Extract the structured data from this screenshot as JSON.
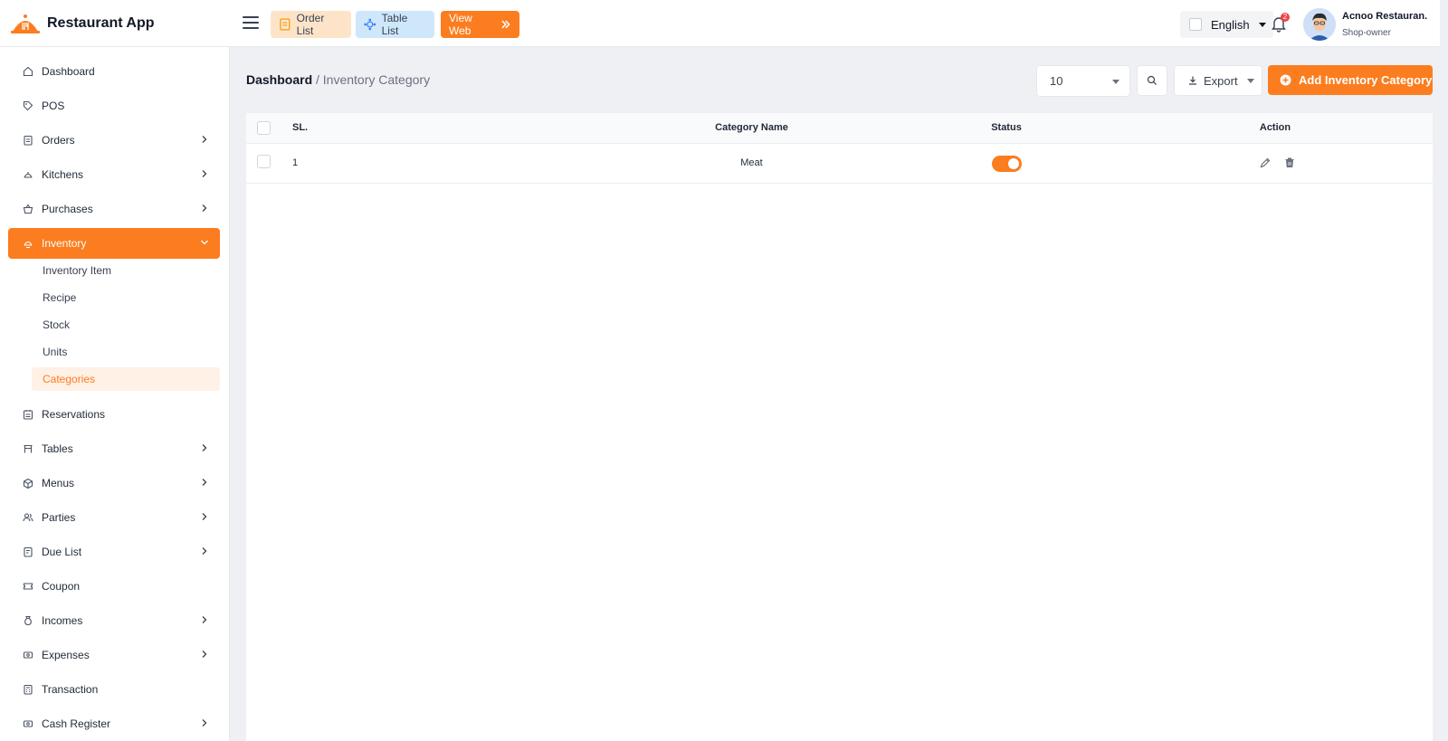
{
  "header": {
    "brand": "Restaurant App",
    "buttons": {
      "order_list": "Order List",
      "table_list": "Table List",
      "view_web": "View Web"
    },
    "language": "English",
    "notification_count": "2",
    "user": {
      "name": "Acnoo Restauran.",
      "role": "Shop-owner"
    }
  },
  "sidebar": {
    "items": [
      {
        "label": "Dashboard"
      },
      {
        "label": "POS"
      },
      {
        "label": "Orders"
      },
      {
        "label": "Kitchens"
      },
      {
        "label": "Purchases"
      },
      {
        "label": "Inventory"
      },
      {
        "label": "Reservations"
      },
      {
        "label": "Tables"
      },
      {
        "label": "Menus"
      },
      {
        "label": "Parties"
      },
      {
        "label": "Due List"
      },
      {
        "label": "Coupon"
      },
      {
        "label": "Incomes"
      },
      {
        "label": "Expenses"
      },
      {
        "label": "Transaction"
      },
      {
        "label": "Cash Register"
      }
    ],
    "inventory_sub": [
      {
        "label": "Inventory Item"
      },
      {
        "label": "Recipe"
      },
      {
        "label": "Stock"
      },
      {
        "label": "Units"
      },
      {
        "label": "Categories"
      }
    ]
  },
  "main": {
    "breadcrumb": {
      "home": "Dashboard",
      "separator": " / ",
      "current": "Inventory Category"
    },
    "page_size": "10",
    "export_label": "Export",
    "add_label": "Add Inventory Category",
    "table": {
      "headers": {
        "sl": "SL.",
        "name": "Category Name",
        "status": "Status",
        "action": "Action"
      },
      "rows": [
        {
          "sl": "1",
          "name": "Meat",
          "status_on": true
        }
      ]
    }
  },
  "colors": {
    "accent": "#fb7d1f",
    "order_btn_bg": "#fde4c8",
    "table_btn_bg": "#cfe7fb"
  }
}
